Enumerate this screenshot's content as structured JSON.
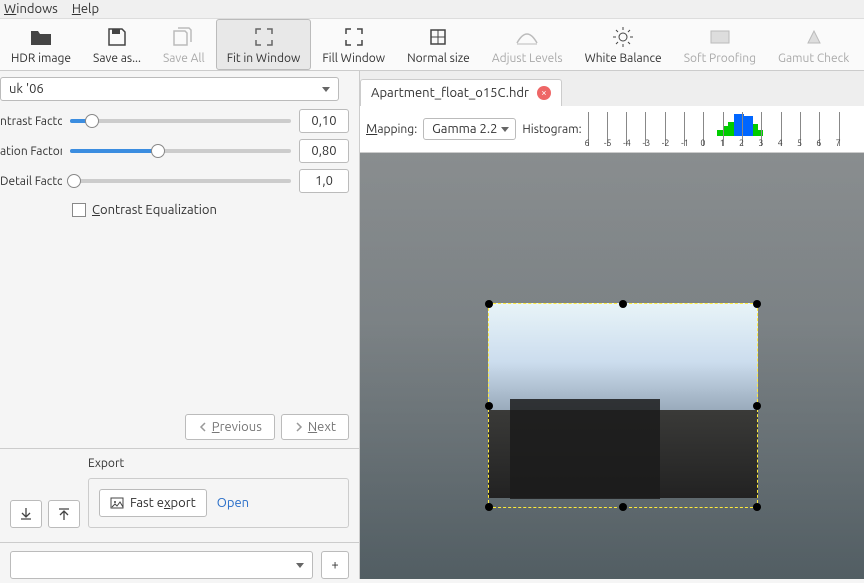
{
  "menu": {
    "windows": "Windows",
    "help": "Help"
  },
  "toolbar": {
    "hdr": "HDR image",
    "saveas": "Save as...",
    "saveall": "Save All",
    "fit": "Fit in Window",
    "fill": "Fill Window",
    "normal": "Normal size",
    "levels": "Adjust Levels",
    "wb": "White Balance",
    "soft": "Soft Proofing",
    "gamut": "Gamut Check"
  },
  "panel": {
    "operator": "uk '06",
    "contrast_label": "ntrast Factor",
    "contrast_val": "0,10",
    "contrast_pct": 10,
    "saturation_label": "ation Factor",
    "saturation_val": "0,80",
    "saturation_pct": 40,
    "detail_label": "Detail Factor",
    "detail_val": "1,0",
    "detail_pct": 2,
    "ceq": "Contrast Equalization",
    "prev": "Previous",
    "next": "Next"
  },
  "export": {
    "title": "Export",
    "fast": "Fast export",
    "open": "Open",
    "plus": "+"
  },
  "tab": {
    "name": "Apartment_float_o15C.hdr"
  },
  "mapping": {
    "label": "Mapping:",
    "value": "Gamma 2.2",
    "histo_label": "Histogram:",
    "ticks": [
      "6",
      "-5",
      "-4",
      "-3",
      "-2",
      "-1",
      "0",
      "1",
      "2",
      "3",
      "4",
      "5",
      "6",
      "7"
    ]
  }
}
